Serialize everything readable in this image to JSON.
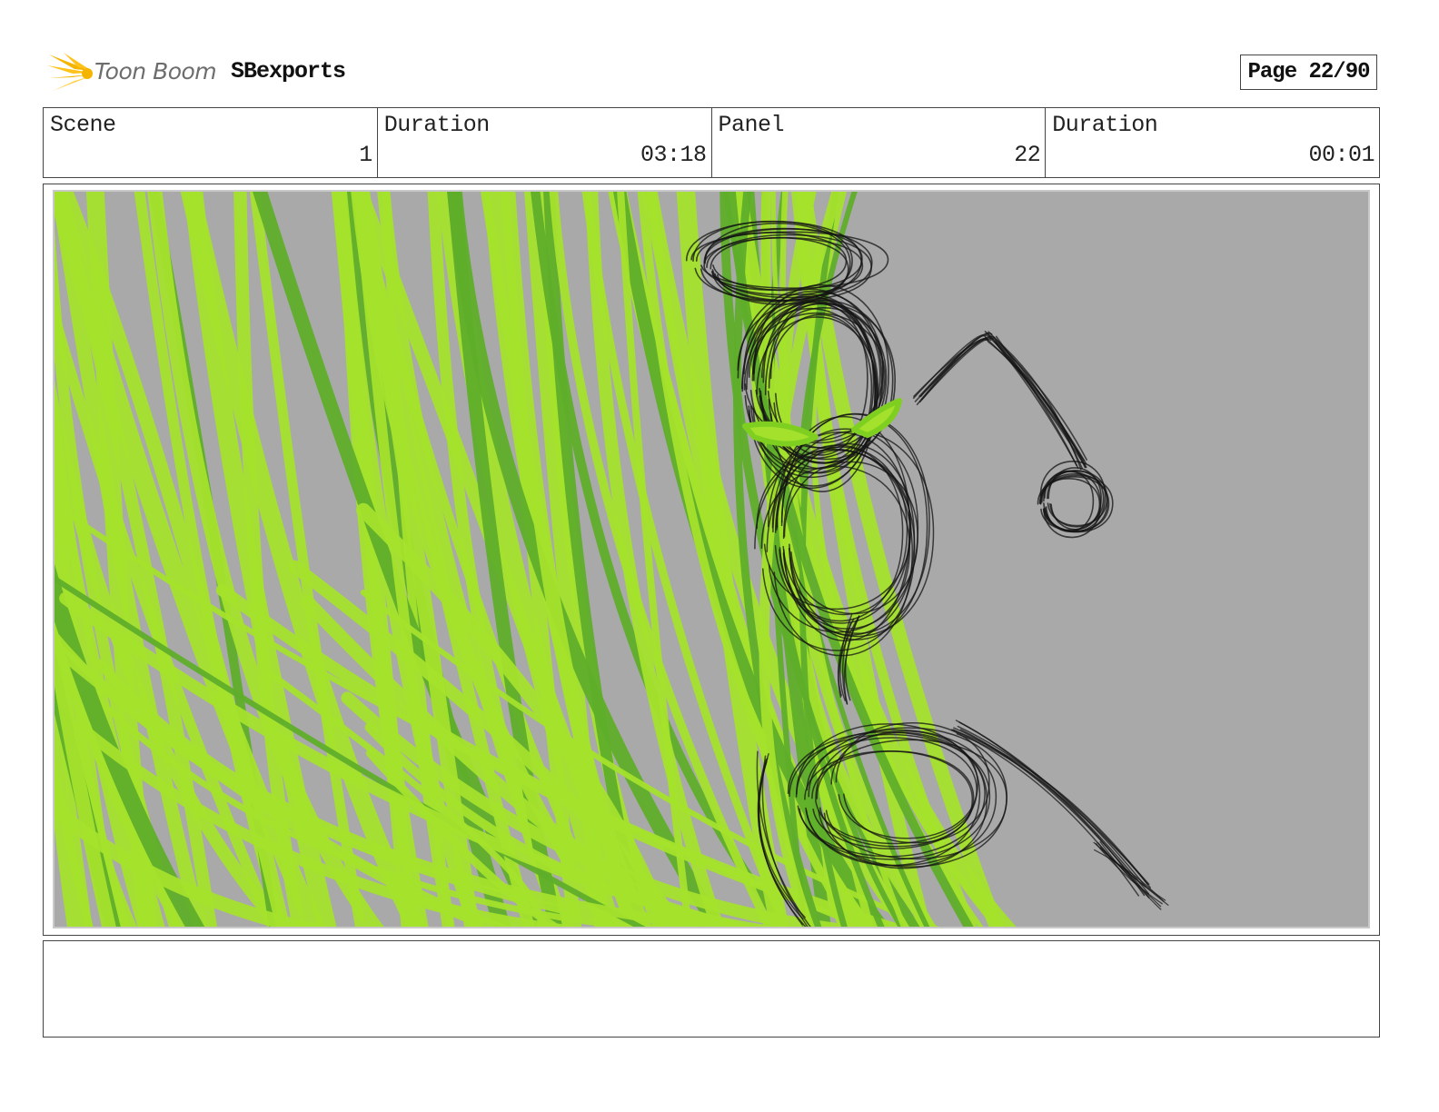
{
  "header": {
    "logo_text": "Toon Boom",
    "project_name": "SBexports",
    "page_label": "Page 22/90"
  },
  "info": [
    {
      "label": "Scene",
      "value": "1"
    },
    {
      "label": "Duration",
      "value": "03:18"
    },
    {
      "label": "Panel",
      "value": "22"
    },
    {
      "label": "Duration",
      "value": "00:01"
    }
  ],
  "panel": {
    "background_color": "#a9a9a9",
    "energy_color": "#a4e12c",
    "energy_dark_color": "#5fae2a",
    "ink_color": "#141414"
  },
  "notes": {
    "text": ""
  },
  "colors": {
    "logo_flame": "#f5b400",
    "logo_flame_light": "#ffd24a",
    "border": "#444444"
  }
}
